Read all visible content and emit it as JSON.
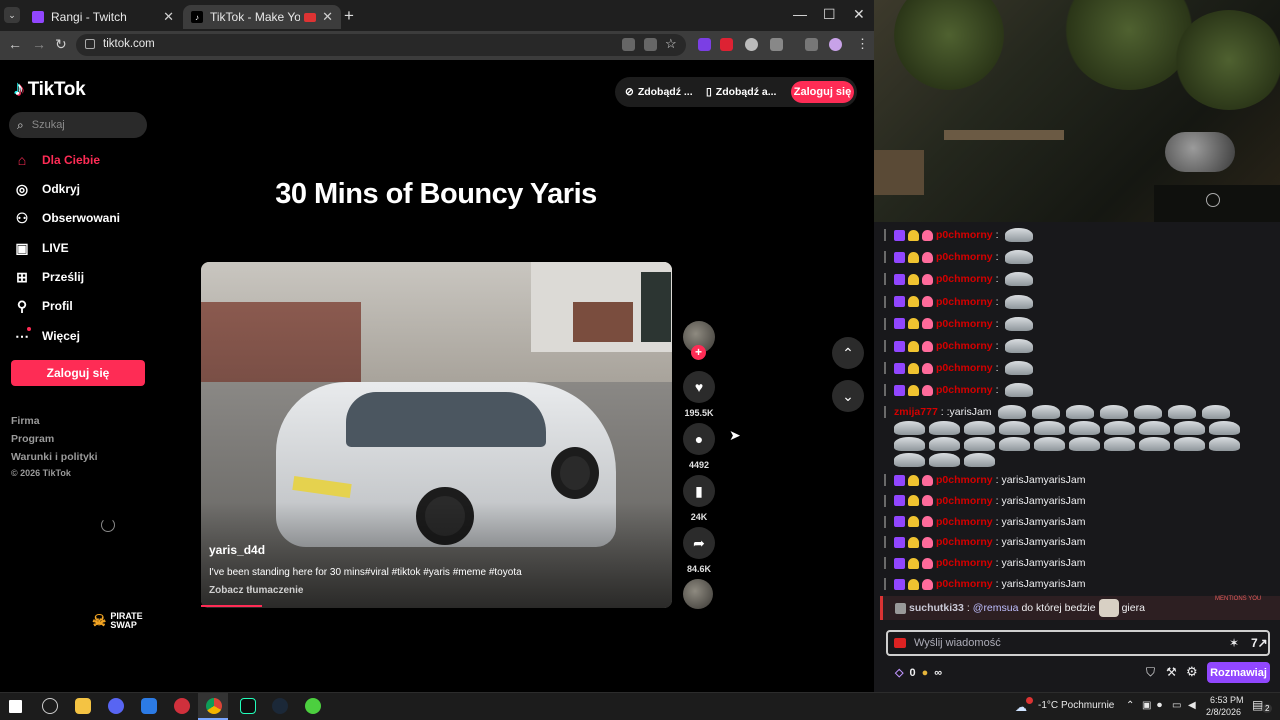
{
  "browser": {
    "tabs": [
      {
        "title": "Rangi - Twitch",
        "active": false
      },
      {
        "title": "TikTok - Make Your Day",
        "active": true
      }
    ],
    "url": "tiktok.com",
    "controls": {
      "minimize": "—",
      "maximize": "☐",
      "close": "✕"
    }
  },
  "tiktok": {
    "brand": "TikTok",
    "search_placeholder": "Szukaj",
    "nav": [
      {
        "label": "Dla Ciebie",
        "icon": "home-icon",
        "active": true
      },
      {
        "label": "Odkryj",
        "icon": "compass-icon",
        "active": false
      },
      {
        "label": "Obserwowani",
        "icon": "following-icon",
        "active": false
      },
      {
        "label": "LIVE",
        "icon": "live-icon",
        "active": false
      },
      {
        "label": "Prześlij",
        "icon": "upload-icon",
        "active": false
      },
      {
        "label": "Profil",
        "icon": "profile-icon",
        "active": false
      },
      {
        "label": "Więcej",
        "icon": "more-icon",
        "active": false
      }
    ],
    "login_label": "Zaloguj się",
    "footer": [
      "Firma",
      "Program",
      "Warunki i polityki"
    ],
    "copyright": "© 2026 TikTok",
    "pirate_swap": [
      "PIRATE",
      "SWAP"
    ],
    "top_buttons": [
      "Zdobądź ...",
      "Zdobądź a..."
    ],
    "video": {
      "title": "30 Mins of Bouncy Yaris",
      "author": "yaris_d4d",
      "description": "I've been standing here for 30 mins#viral #tiktok #yaris #meme #toyota",
      "translate": "Zobacz tłumaczenie",
      "progress": 0.13
    },
    "actions": [
      {
        "icon": "heart-icon",
        "count": "195.5K"
      },
      {
        "icon": "comment-icon",
        "count": "4492"
      },
      {
        "icon": "bookmark-icon",
        "count": "24K"
      },
      {
        "icon": "share-icon",
        "count": "84.6K"
      }
    ]
  },
  "twitch": {
    "messages": [
      {
        "user": "p0chmorny",
        "text": "",
        "emotes": 1
      },
      {
        "user": "p0chmorny",
        "text": "",
        "emotes": 1
      },
      {
        "user": "p0chmorny",
        "text": "",
        "emotes": 1
      },
      {
        "user": "p0chmorny",
        "text": "",
        "emotes": 1
      },
      {
        "user": "p0chmorny",
        "text": "",
        "emotes": 1
      },
      {
        "user": "p0chmorny",
        "text": "",
        "emotes": 1
      },
      {
        "user": "p0chmorny",
        "text": "",
        "emotes": 1
      },
      {
        "user": "p0chmorny",
        "text": "",
        "emotes": 1
      }
    ],
    "spam_user": "zmija777",
    "spam_text": ": :yarisJam",
    "jam_messages": [
      {
        "user": "p0chmorny",
        "text": ": yarisJamyarisJam"
      },
      {
        "user": "p0chmorny",
        "text": ": yarisJamyarisJam"
      },
      {
        "user": "p0chmorny",
        "text": ": yarisJamyarisJam"
      },
      {
        "user": "p0chmorny",
        "text": ": yarisJamyarisJam"
      },
      {
        "user": "p0chmorny",
        "text": ": yarisJamyarisJam"
      },
      {
        "user": "p0chmorny",
        "text": ": yarisJamyarisJam"
      }
    ],
    "mention": {
      "label": "MENTIONS YOU",
      "user": "suchutki33",
      "at": "@remsua",
      "text1": "do której bedzie",
      "text2": "giera"
    },
    "input_placeholder": "Wyślij wiadomość",
    "points": "0",
    "infinity": "∞",
    "chat_button": "Rozmawiaj"
  },
  "taskbar": {
    "weather": "-1°C",
    "weather_desc": "Pochmurnie",
    "time": "6:53 PM",
    "date": "2/8/2026",
    "notif_count": "2"
  },
  "colors": {
    "tiktok_red": "#fe2c55",
    "twitch_purple": "#9147ff",
    "chat_user_red": "#d40000"
  }
}
